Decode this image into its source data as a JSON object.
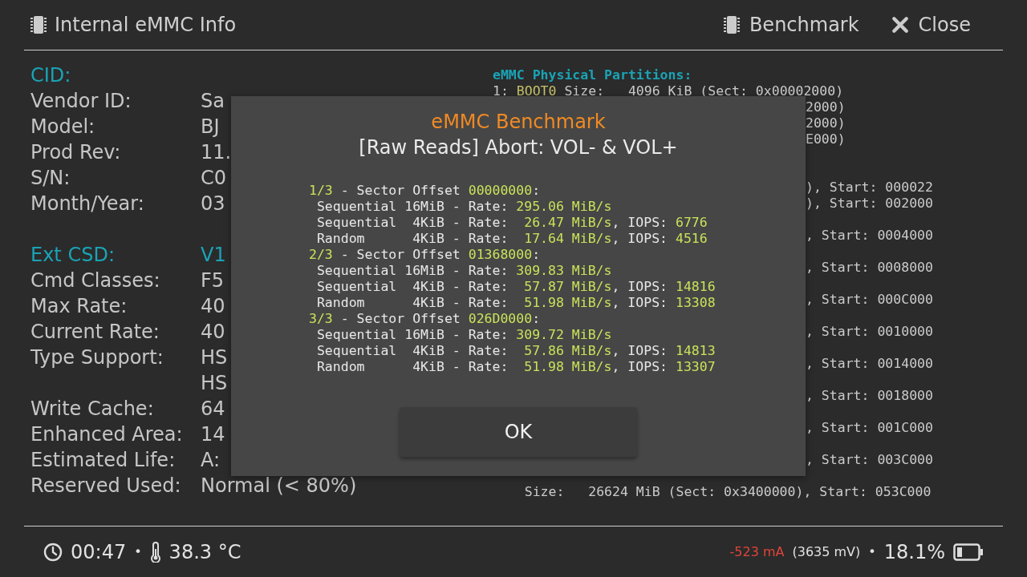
{
  "header": {
    "title": "Internal eMMC Info",
    "actions": [
      {
        "kind": "chip",
        "label": "Benchmark"
      },
      {
        "kind": "close",
        "label": "Close"
      }
    ]
  },
  "info_sections": [
    {
      "heading": "CID:",
      "rows": [
        {
          "label": "Vendor ID:",
          "values": [
            "Sa"
          ]
        },
        {
          "label": "Model:",
          "values": [
            "BJ"
          ]
        },
        {
          "label": "Prod Rev:",
          "values": [
            "11."
          ]
        },
        {
          "label": "S/N:",
          "values": [
            "C0"
          ]
        },
        {
          "label": "Month/Year:",
          "values": [
            "03"
          ]
        }
      ]
    },
    {
      "heading": "Ext CSD:",
      "heading_value": "V1",
      "rows": [
        {
          "label": "Cmd Classes:",
          "values": [
            "F5"
          ]
        },
        {
          "label": "Max Rate:",
          "values": [
            "40"
          ]
        },
        {
          "label": "Current Rate:",
          "values": [
            "40"
          ]
        },
        {
          "label": "Type Support:",
          "values": [
            "HS",
            "HS"
          ]
        },
        {
          "label": "Write Cache:",
          "values": [
            "64"
          ]
        },
        {
          "label": "Enhanced Area:",
          "values": [
            "14"
          ]
        },
        {
          "label": "Estimated Life:",
          "values": [
            "A:"
          ]
        },
        {
          "label": "Reserved Used:",
          "values": [
            "Normal (< 80%)"
          ]
        }
      ]
    }
  ],
  "partitions": {
    "title": "eMMC Physical Partitions:",
    "groups": [
      {
        "kind": "tight",
        "lines": [
          {
            "kind": "full",
            "parts": [
              {
                "kind": "plain",
                "text": "1: "
              },
              {
                "kind": "accent",
                "text": "BOOT0"
              },
              {
                "kind": "plain",
                "text": " Size:   4096 KiB (Sect: 0x00002000)"
              }
            ]
          },
          {
            "kind": "tail",
            "parts": [
              {
                "kind": "plain",
                "text": "2000)"
              }
            ]
          },
          {
            "kind": "tail",
            "parts": [
              {
                "kind": "plain",
                "text": "2000)"
              }
            ]
          },
          {
            "kind": "tail",
            "parts": [
              {
                "kind": "plain",
                "text": "E000)"
              }
            ]
          }
        ]
      },
      {
        "kind": "tight",
        "lines": [
          {
            "kind": "tail",
            "parts": [
              {
                "kind": "plain",
                "text": "), Start: 000022"
              }
            ]
          },
          {
            "kind": "tail",
            "parts": [
              {
                "kind": "plain",
                "text": "), Start: 002000"
              }
            ]
          }
        ]
      },
      {
        "kind": "loose",
        "lines": [
          {
            "kind": "tail",
            "parts": [
              {
                "kind": "plain",
                "text": ", Start: 0004000"
              }
            ]
          },
          {
            "kind": "tail",
            "parts": [
              {
                "kind": "plain",
                "text": ", Start: 0008000"
              }
            ]
          },
          {
            "kind": "tail",
            "parts": [
              {
                "kind": "plain",
                "text": ", Start: 000C000"
              }
            ]
          },
          {
            "kind": "tail",
            "parts": [
              {
                "kind": "plain",
                "text": ", Start: 0010000"
              }
            ]
          },
          {
            "kind": "tail",
            "parts": [
              {
                "kind": "plain",
                "text": ", Start: 0014000"
              }
            ]
          },
          {
            "kind": "tail",
            "parts": [
              {
                "kind": "plain",
                "text": ", Start: 0018000"
              }
            ]
          },
          {
            "kind": "tail",
            "parts": [
              {
                "kind": "plain",
                "text": ", Start: 001C000"
              }
            ]
          },
          {
            "kind": "tail",
            "parts": [
              {
                "kind": "plain",
                "text": ", Start: 003C000"
              }
            ]
          },
          {
            "kind": "full",
            "parts": [
              {
                "kind": "plain",
                "text": "    Size:   26624 MiB (Sect: 0x3400000), Start: 053C000"
              }
            ]
          }
        ]
      }
    ]
  },
  "dialog": {
    "title": "eMMC Benchmark",
    "subtitle": "[Raw Reads] Abort: VOL- & VOL+",
    "lines": [
      [
        {
          "kind": "accent",
          "text": "1/3"
        },
        {
          "kind": "plain",
          "text": " - Sector Offset "
        },
        {
          "kind": "accent",
          "text": "00000000"
        },
        {
          "kind": "plain",
          "text": ":"
        }
      ],
      [
        {
          "kind": "plain",
          "text": " Sequential 16MiB - Rate: "
        },
        {
          "kind": "accent",
          "text": "295.06 MiB/s"
        }
      ],
      [
        {
          "kind": "plain",
          "text": " Sequential  4KiB - Rate:  "
        },
        {
          "kind": "accent",
          "text": "26.47 MiB/s"
        },
        {
          "kind": "plain",
          "text": ", IOPS: "
        },
        {
          "kind": "accent",
          "text": "6776"
        }
      ],
      [
        {
          "kind": "plain",
          "text": " Random      4KiB - Rate:  "
        },
        {
          "kind": "accent",
          "text": "17.64 MiB/s"
        },
        {
          "kind": "plain",
          "text": ", IOPS: "
        },
        {
          "kind": "accent",
          "text": "4516"
        }
      ],
      [
        {
          "kind": "accent",
          "text": "2/3"
        },
        {
          "kind": "plain",
          "text": " - Sector Offset "
        },
        {
          "kind": "accent",
          "text": "01368000"
        },
        {
          "kind": "plain",
          "text": ":"
        }
      ],
      [
        {
          "kind": "plain",
          "text": " Sequential 16MiB - Rate: "
        },
        {
          "kind": "accent",
          "text": "309.83 MiB/s"
        }
      ],
      [
        {
          "kind": "plain",
          "text": " Sequential  4KiB - Rate:  "
        },
        {
          "kind": "accent",
          "text": "57.87 MiB/s"
        },
        {
          "kind": "plain",
          "text": ", IOPS: "
        },
        {
          "kind": "accent",
          "text": "14816"
        }
      ],
      [
        {
          "kind": "plain",
          "text": " Random      4KiB - Rate:  "
        },
        {
          "kind": "accent",
          "text": "51.98 MiB/s"
        },
        {
          "kind": "plain",
          "text": ", IOPS: "
        },
        {
          "kind": "accent",
          "text": "13308"
        }
      ],
      [
        {
          "kind": "accent",
          "text": "3/3"
        },
        {
          "kind": "plain",
          "text": " - Sector Offset "
        },
        {
          "kind": "accent",
          "text": "026D0000"
        },
        {
          "kind": "plain",
          "text": ":"
        }
      ],
      [
        {
          "kind": "plain",
          "text": " Sequential 16MiB - Rate: "
        },
        {
          "kind": "accent",
          "text": "309.72 MiB/s"
        }
      ],
      [
        {
          "kind": "plain",
          "text": " Sequential  4KiB - Rate:  "
        },
        {
          "kind": "accent",
          "text": "57.86 MiB/s"
        },
        {
          "kind": "plain",
          "text": ", IOPS: "
        },
        {
          "kind": "accent",
          "text": "14813"
        }
      ],
      [
        {
          "kind": "plain",
          "text": " Random      4KiB - Rate:  "
        },
        {
          "kind": "accent",
          "text": "51.98 MiB/s"
        },
        {
          "kind": "plain",
          "text": ", IOPS: "
        },
        {
          "kind": "accent",
          "text": "13307"
        }
      ]
    ],
    "button": "OK"
  },
  "status_bar": {
    "time": "00:47",
    "separator_left": "•",
    "temperature": "38.3 °C",
    "current": "-523 mA",
    "voltage": "(3635 mV)",
    "separator_right": "•",
    "battery": "18.1%"
  }
}
